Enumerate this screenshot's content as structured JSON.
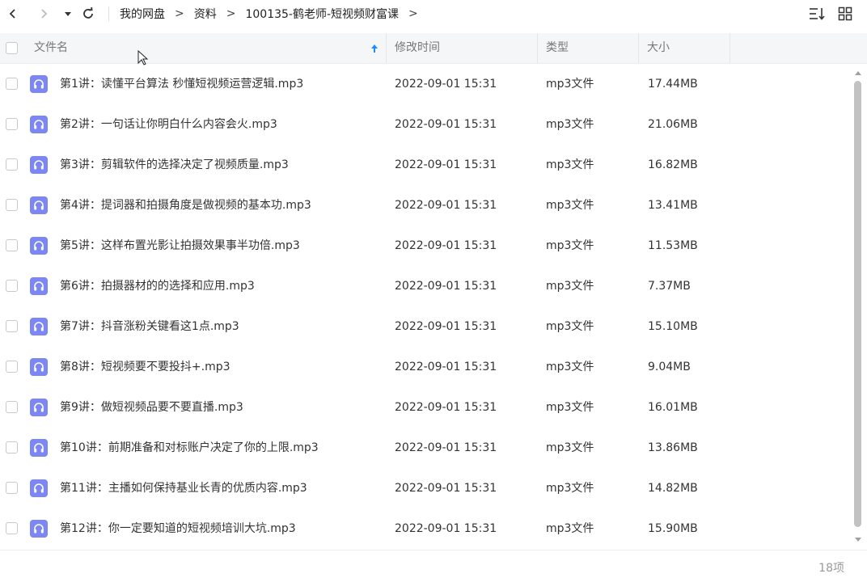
{
  "toolbar": {
    "back_icon": "chevron-left-icon",
    "forward_icon": "chevron-right-icon",
    "dropdown_icon": "caret-down-icon",
    "refresh_icon": "refresh-icon",
    "breadcrumb": [
      "我的网盘",
      "资料",
      "100135-鹤老师-短视频财富课"
    ],
    "separator": ">",
    "sort_icon": "sort-list-icon",
    "grid_icon": "grid-view-icon"
  },
  "table": {
    "headers": {
      "name": "文件名",
      "modified": "修改时间",
      "type": "类型",
      "size": "大小"
    },
    "sort_indicator_color": "#1a8cff",
    "rows": [
      {
        "name": "第1讲：读懂平台算法 秒懂短视频运营逻辑.mp3",
        "modified": "2022-09-01 15:31",
        "type": "mp3文件",
        "size": "17.44MB"
      },
      {
        "name": "第2讲：一句话让你明白什么内容会火.mp3",
        "modified": "2022-09-01 15:31",
        "type": "mp3文件",
        "size": "21.06MB"
      },
      {
        "name": "第3讲：剪辑软件的选择决定了视频质量.mp3",
        "modified": "2022-09-01 15:31",
        "type": "mp3文件",
        "size": "16.82MB"
      },
      {
        "name": "第4讲：提词器和拍摄角度是做视频的基本功.mp3",
        "modified": "2022-09-01 15:31",
        "type": "mp3文件",
        "size": "13.41MB"
      },
      {
        "name": "第5讲：这样布置光影让拍摄效果事半功倍.mp3",
        "modified": "2022-09-01 15:31",
        "type": "mp3文件",
        "size": "11.53MB"
      },
      {
        "name": "第6讲：拍摄器材的的选择和应用.mp3",
        "modified": "2022-09-01 15:31",
        "type": "mp3文件",
        "size": "7.37MB"
      },
      {
        "name": "第7讲：抖音涨粉关键看这1点.mp3",
        "modified": "2022-09-01 15:31",
        "type": "mp3文件",
        "size": "15.10MB"
      },
      {
        "name": "第8讲：短视频要不要投抖+.mp3",
        "modified": "2022-09-01 15:31",
        "type": "mp3文件",
        "size": "9.04MB"
      },
      {
        "name": "第9讲：做短视频品要不要直播.mp3",
        "modified": "2022-09-01 15:31",
        "type": "mp3文件",
        "size": "16.01MB"
      },
      {
        "name": "第10讲：前期准备和对标账户决定了你的上限.mp3",
        "modified": "2022-09-01 15:31",
        "type": "mp3文件",
        "size": "13.86MB"
      },
      {
        "name": "第11讲：主播如何保持基业长青的优质内容.mp3",
        "modified": "2022-09-01 15:31",
        "type": "mp3文件",
        "size": "14.82MB"
      },
      {
        "name": "第12讲：你一定要知道的短视频培训大坑.mp3",
        "modified": "2022-09-01 15:31",
        "type": "mp3文件",
        "size": "15.90MB"
      }
    ],
    "file_icon": "headphones-audio-icon",
    "file_icon_color": "#7c86f4"
  },
  "footer": {
    "item_count": "18项"
  }
}
